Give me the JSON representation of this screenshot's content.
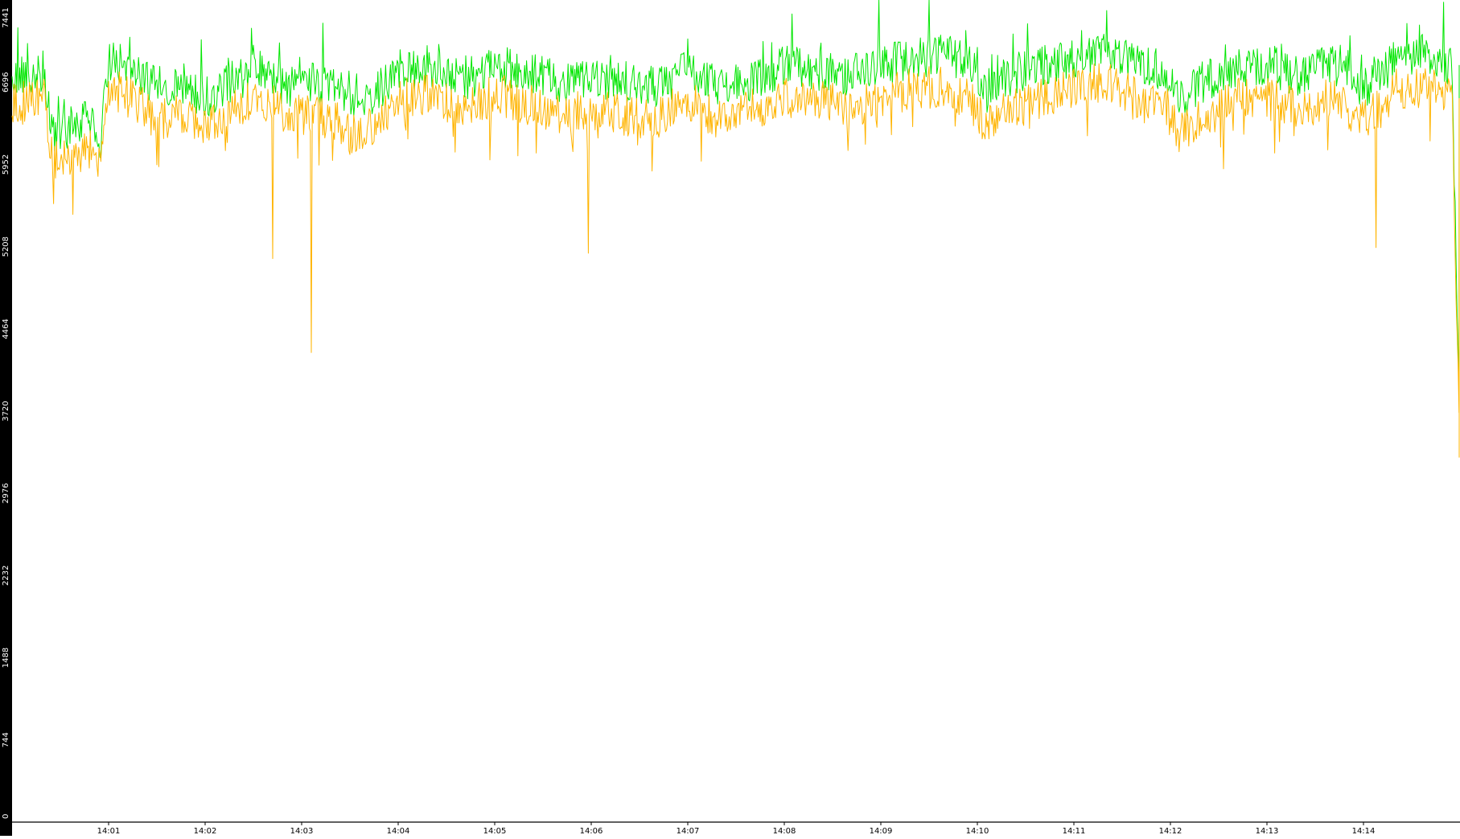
{
  "chart_data": {
    "type": "line",
    "title": "",
    "xlabel": "",
    "ylabel": "",
    "ylim": [
      0,
      7441
    ],
    "y_ticks": [
      "0",
      "744",
      "1488",
      "2232",
      "2976",
      "3720",
      "4464",
      "5208",
      "5952",
      "6696",
      "7441"
    ],
    "x_range": [
      "14:00:00",
      "14:15:00"
    ],
    "x_ticks": [
      "14:01",
      "14:02",
      "14:03",
      "14:04",
      "14:05",
      "14:06",
      "14:07",
      "14:08",
      "14:09",
      "14:10",
      "14:11",
      "14:12",
      "14:13",
      "14:14"
    ],
    "grid": false,
    "legend": "none",
    "colors": {
      "upper_series": "#00e600",
      "lower_series": "#ffb400",
      "axis": "#000000",
      "background": "#ffffff"
    },
    "series": [
      {
        "color": "#00e600",
        "x": [
          "14:00:00",
          "14:00:20",
          "14:00:25",
          "14:00:40",
          "14:00:50",
          "14:00:55",
          "14:01:00",
          "14:01:15",
          "14:01:30",
          "14:01:45",
          "14:02:00",
          "14:02:15",
          "14:02:35",
          "14:02:50",
          "14:03:00",
          "14:03:20",
          "14:03:35",
          "14:03:50",
          "14:04:00",
          "14:04:20",
          "14:04:40",
          "14:05:00",
          "14:05:20",
          "14:05:40",
          "14:06:00",
          "14:06:20",
          "14:06:40",
          "14:07:00",
          "14:07:20",
          "14:07:40",
          "14:08:00",
          "14:08:20",
          "14:08:40",
          "14:09:00",
          "14:09:20",
          "14:09:40",
          "14:09:55",
          "14:10:05",
          "14:10:20",
          "14:10:40",
          "14:11:00",
          "14:11:20",
          "14:11:40",
          "14:12:00",
          "14:12:05",
          "14:12:20",
          "14:12:40",
          "14:13:00",
          "14:13:20",
          "14:13:40",
          "14:14:00",
          "14:14:10",
          "14:14:20",
          "14:14:40",
          "14:14:55",
          "14:15:00"
        ],
        "values": [
          6750,
          6800,
          6250,
          6300,
          6400,
          6150,
          6900,
          6800,
          6650,
          6700,
          6550,
          6700,
          6800,
          6650,
          6700,
          6650,
          6500,
          6650,
          6800,
          6850,
          6700,
          6850,
          6800,
          6700,
          6750,
          6700,
          6650,
          6800,
          6650,
          6700,
          6850,
          6800,
          6750,
          6850,
          6900,
          6950,
          6850,
          6600,
          6750,
          6850,
          6900,
          6950,
          6850,
          6750,
          6500,
          6700,
          6800,
          6850,
          6750,
          6850,
          6650,
          6750,
          6900,
          6950,
          6850,
          3400
        ]
      },
      {
        "color": "#ffb400",
        "x": [
          "14:00:00",
          "14:00:20",
          "14:00:25",
          "14:00:40",
          "14:00:50",
          "14:00:55",
          "14:01:00",
          "14:01:15",
          "14:01:30",
          "14:01:45",
          "14:02:00",
          "14:02:15",
          "14:02:35",
          "14:02:50",
          "14:03:00",
          "14:03:20",
          "14:03:35",
          "14:03:50",
          "14:04:00",
          "14:04:20",
          "14:04:40",
          "14:05:00",
          "14:05:20",
          "14:05:40",
          "14:06:00",
          "14:06:20",
          "14:06:40",
          "14:07:00",
          "14:07:20",
          "14:07:40",
          "14:08:00",
          "14:08:20",
          "14:08:40",
          "14:09:00",
          "14:09:20",
          "14:09:40",
          "14:09:55",
          "14:10:05",
          "14:10:20",
          "14:10:40",
          "14:11:00",
          "14:11:20",
          "14:11:40",
          "14:12:00",
          "14:12:05",
          "14:12:20",
          "14:12:40",
          "14:13:00",
          "14:13:20",
          "14:13:40",
          "14:14:00",
          "14:14:10",
          "14:14:20",
          "14:14:40",
          "14:14:55",
          "14:15:00"
        ],
        "values": [
          6500,
          6550,
          6000,
          6050,
          6100,
          5950,
          6650,
          6550,
          6350,
          6400,
          6250,
          6450,
          6550,
          6400,
          6400,
          6350,
          6200,
          6350,
          6550,
          6600,
          6400,
          6600,
          6500,
          6400,
          6450,
          6400,
          6350,
          6550,
          6350,
          6450,
          6550,
          6550,
          6450,
          6550,
          6650,
          6650,
          6550,
          6300,
          6450,
          6550,
          6650,
          6700,
          6550,
          6450,
          6200,
          6400,
          6550,
          6550,
          6450,
          6550,
          6350,
          6450,
          6650,
          6650,
          6550,
          3300
        ]
      }
    ],
    "annotations": [
      {
        "type": "spike",
        "series": 1,
        "x": "14:02:42",
        "value": 5100
      },
      {
        "type": "spike",
        "series": 1,
        "x": "14:03:06",
        "value": 4250
      },
      {
        "type": "spike",
        "series": 1,
        "x": "14:05:58",
        "value": 5150
      },
      {
        "type": "spike",
        "series": 1,
        "x": "14:14:08",
        "value": 5200
      }
    ]
  }
}
